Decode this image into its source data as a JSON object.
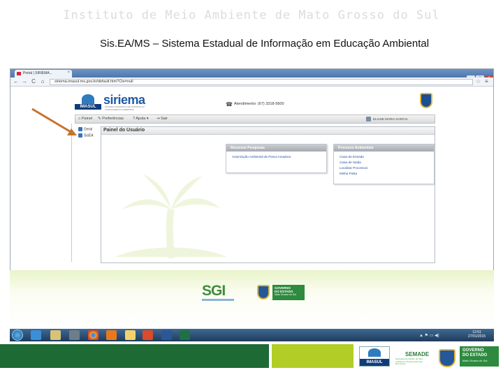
{
  "slide": {
    "title": "Instituto de Meio Ambiente de Mato Grosso do Sul",
    "subtitle": "Sis.EA/MS – Sistema Estadual de Informação em Educação Ambiental"
  },
  "browser": {
    "tab_title": "Portal | SIRIEMA...",
    "tab_close": "×",
    "window_buttons": [
      "–",
      "□",
      "×"
    ],
    "nav": {
      "back": "←",
      "forward": "→",
      "reload": "C",
      "home": "⌂"
    },
    "url": "siriema.imasul.ms.gov.br/default.htm?Cte=null",
    "star": "☆",
    "menu": "≡"
  },
  "site": {
    "logo_imasul": "IMASUL",
    "logo_siriema": "siriema",
    "siriema_tagline": "SISTEMA INTERATIVO DE SUPORTE AO LICENCIAMENTO AMBIENTAL",
    "atendimento": "Atendimento: (67) 3318-5600"
  },
  "toolbar": {
    "items": [
      "⌂ Painel",
      "✎ Preferências",
      "? Ajuda ▾",
      "⇥ Sair"
    ],
    "user": "ELIANE MARIA GARCIA"
  },
  "tree": {
    "items": [
      "Geral",
      "SisEA"
    ]
  },
  "panel": {
    "title": "Painel do Usuário",
    "recent_box": {
      "title": "Recursos Pesquisas",
      "links": [
        "Autorização Ambiental de Pesca Amadora"
      ]
    },
    "process_box": {
      "title": "Processo Ambientais",
      "links": [
        "Caixa de Entrada",
        "Caixa de Saída",
        "Localizar Processos",
        "Minha Pasta"
      ]
    }
  },
  "bottom": {
    "sgi": "SGI",
    "gov_box": [
      "GOVERNO",
      "DO ESTADO",
      "Mato Grosso do Sul"
    ]
  },
  "taskbar": {
    "clock_time": "12:51",
    "clock_date": "27/01/2015",
    "tray": "▲ ⚑ ▭ ◀)"
  },
  "footer": {
    "imasul": "IMASUL",
    "semade": "SEMADE",
    "semade_tagline": "Secretaria de Estado de Meio Ambiente e Desenvolvimento Econômico",
    "gov": [
      "GOVERNO",
      "DO ESTADO",
      "Mato Grosso do Sul"
    ]
  },
  "colors": {
    "arrow": "#c8732a",
    "footer_green": "#1e6a34",
    "footer_yellow": "#b2cd25",
    "brand_blue": "#1f5aa6"
  }
}
